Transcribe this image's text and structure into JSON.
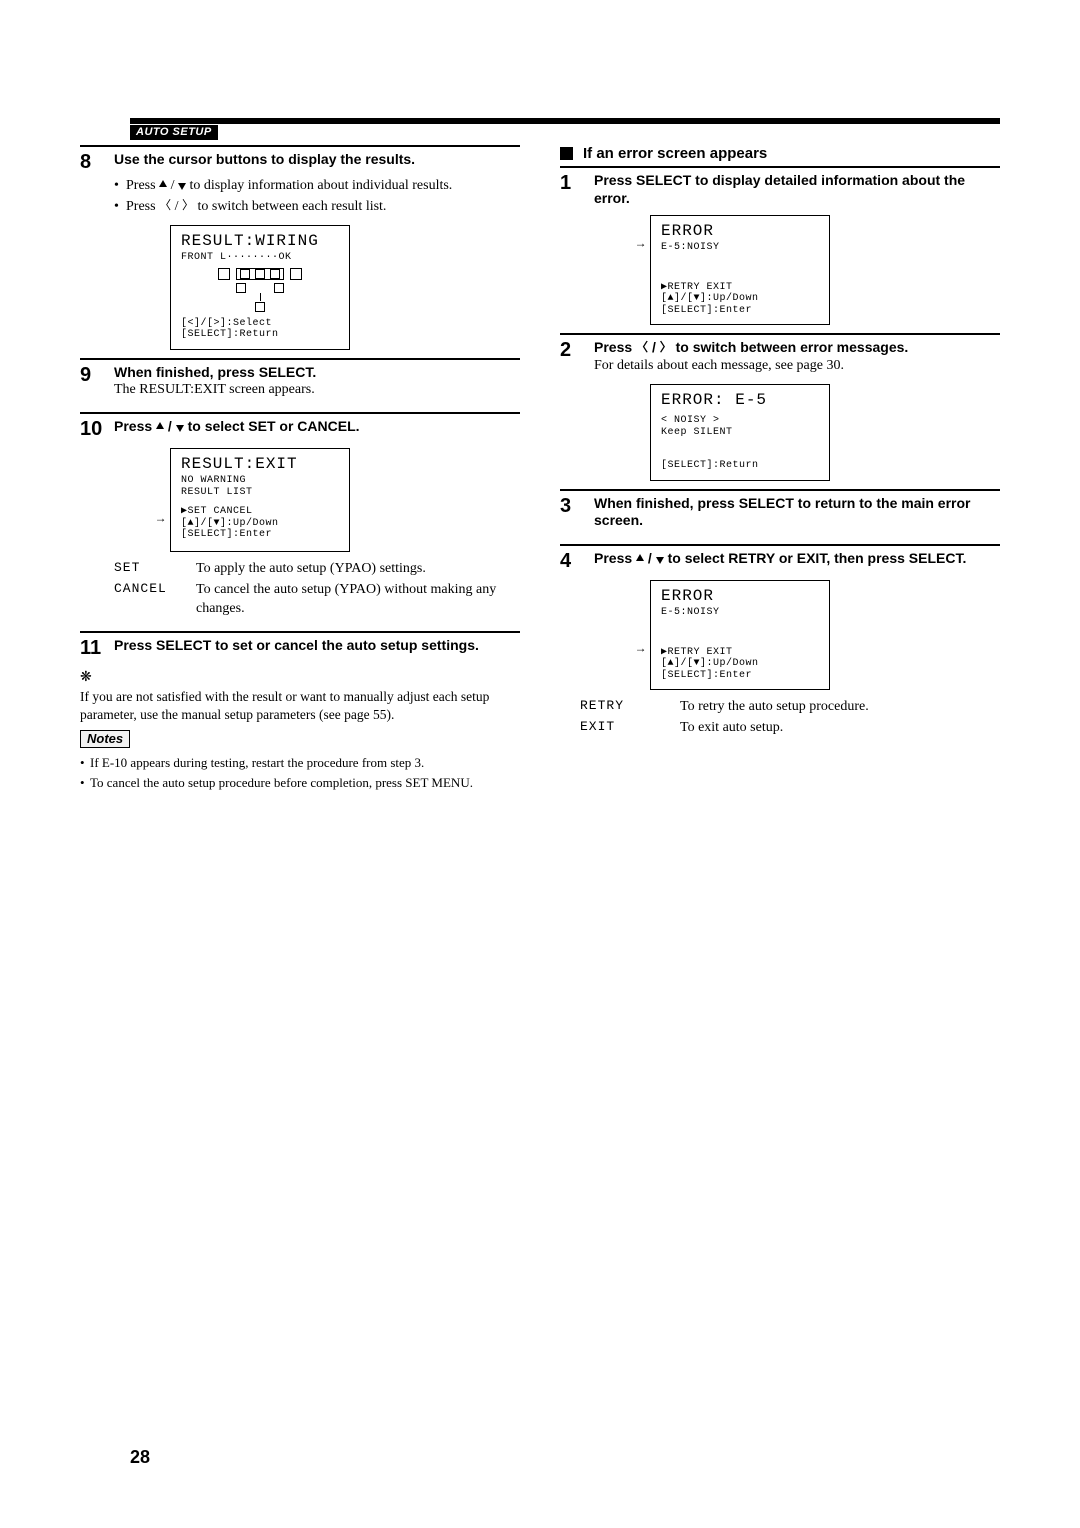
{
  "section_tag": "AUTO SETUP",
  "page_number": "28",
  "left": {
    "step8": {
      "num": "8",
      "title": "Use the cursor buttons to display the results.",
      "bullet1a": "Press ",
      "bullet1b": " / ",
      "bullet1c": " to display information about individual results.",
      "bullet2a": "Press ",
      "bullet2b": " / ",
      "bullet2c": " to switch between each result list."
    },
    "screen8": {
      "title": "RESULT:WIRING",
      "line1": "FRONT L········OK",
      "footer1": "[<]/[>]:Select",
      "footer2": "[SELECT]:Return"
    },
    "step9": {
      "num": "9",
      "title": "When finished, press SELECT.",
      "body": "The RESULT:EXIT screen appears."
    },
    "step10": {
      "num": "10",
      "title_a": "Press ",
      "title_b": " / ",
      "title_c": " to select SET or CANCEL."
    },
    "screen10": {
      "title": "RESULT:EXIT",
      "line1": "NO WARNING",
      "line2": "RESULT LIST",
      "line3": "▶SET    CANCEL",
      "footer1": "[▲]/[▼]:Up/Down",
      "footer2": "[SELECT]:Enter"
    },
    "defs10": {
      "set_term": "SET",
      "set_desc": "To apply the auto setup (YPAO) settings.",
      "cancel_term": "CANCEL",
      "cancel_desc": "To cancel the auto setup (YPAO) without making any changes."
    },
    "step11": {
      "num": "11",
      "title": "Press SELECT to set or cancel the auto setup settings."
    },
    "hint": "If you are not satisfied with the result or want to manually adjust each setup parameter, use the manual setup parameters (see page 55).",
    "notes_label": "Notes",
    "note1": "If E-10 appears during testing, restart the procedure from step 3.",
    "note2": "To cancel the auto setup procedure before completion, press SET MENU."
  },
  "right": {
    "heading": "If an error screen appears",
    "step1": {
      "num": "1",
      "title": "Press SELECT to display detailed information about the error."
    },
    "screen1": {
      "title": "ERROR",
      "line1": "E-5:NOISY",
      "line2": "▶RETRY  EXIT",
      "footer1": "[▲]/[▼]:Up/Down",
      "footer2": "[SELECT]:Enter"
    },
    "step2": {
      "num": "2",
      "title_a": "Press ",
      "title_b": " / ",
      "title_c": " to switch between error messages.",
      "body": "For details about each message, see page 30."
    },
    "screen2": {
      "title": "ERROR: E-5",
      "line1": "< NOISY >",
      "line2": "Keep SILENT",
      "footer1": "[SELECT]:Return"
    },
    "step3": {
      "num": "3",
      "title": "When finished, press SELECT to return to the main error screen."
    },
    "step4": {
      "num": "4",
      "title_a": "Press ",
      "title_b": " / ",
      "title_c": " to select RETRY or EXIT, then press SELECT."
    },
    "screen4": {
      "title": "ERROR",
      "line1": "E-5:NOISY",
      "line2": "▶RETRY  EXIT",
      "footer1": "[▲]/[▼]:Up/Down",
      "footer2": "[SELECT]:Enter"
    },
    "defs4": {
      "retry_term": "RETRY",
      "retry_desc": "To retry the auto setup procedure.",
      "exit_term": "EXIT",
      "exit_desc": "To exit auto setup."
    }
  }
}
